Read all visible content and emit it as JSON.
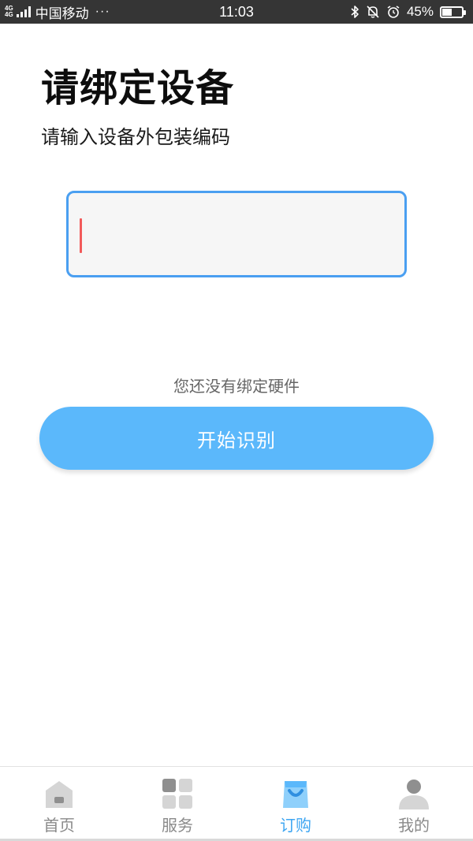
{
  "status_bar": {
    "network_top": "4G",
    "network_bottom": "4G",
    "carrier": "中国移动",
    "dots": "···",
    "time": "11:03",
    "battery_percent_label": "45%",
    "battery_level": 0.45,
    "icons": [
      "bluetooth-icon",
      "mute-bell-icon",
      "alarm-icon",
      "battery-icon"
    ]
  },
  "page": {
    "title": "请绑定设备",
    "subtitle": "请输入设备外包装编码",
    "code_input": {
      "value": "",
      "placeholder": ""
    },
    "hint": "您还没有绑定硬件",
    "start_button_label": "开始识别"
  },
  "colors": {
    "accent": "#5bb8fb",
    "input_border": "#4a9ff1",
    "caret": "#f25a5a",
    "tab_active": "#3ea6f2",
    "tab_inactive": "#8a8a8a"
  },
  "tabbar": {
    "tabs": [
      {
        "label": "首页",
        "icon": "home-icon",
        "active": false
      },
      {
        "label": "服务",
        "icon": "grid-icon",
        "active": false
      },
      {
        "label": "订购",
        "icon": "shopping-bag-icon",
        "active": true
      },
      {
        "label": "我的",
        "icon": "profile-icon",
        "active": false
      }
    ]
  }
}
